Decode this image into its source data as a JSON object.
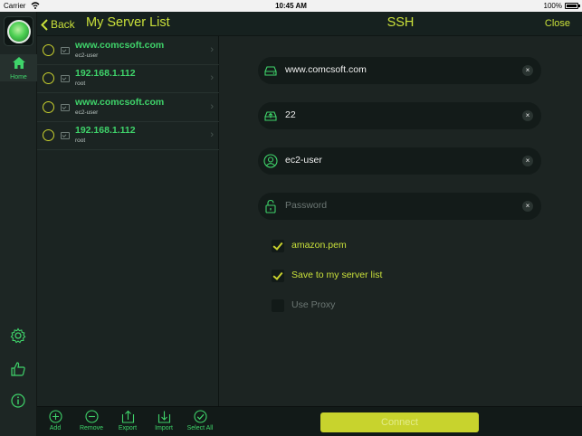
{
  "status_bar": {
    "carrier": "Carrier",
    "time": "10:45 AM",
    "battery": "100%"
  },
  "rail": {
    "home_label": "Home"
  },
  "server_list": {
    "back_label": "Back",
    "title": "My Server List",
    "servers": [
      {
        "host": "www.comcsoft.com",
        "user": "ec2-user"
      },
      {
        "host": "192.168.1.112",
        "user": "root"
      },
      {
        "host": "www.comcsoft.com",
        "user": "ec2-user"
      },
      {
        "host": "192.168.1.112",
        "user": "root"
      }
    ],
    "toolbar": {
      "add": "Add",
      "remove": "Remove",
      "export": "Export",
      "import": "Import",
      "select_all": "Select All"
    }
  },
  "ssh_form": {
    "title": "SSH",
    "close_label": "Close",
    "host_value": "www.comcsoft.com",
    "port_value": "22",
    "username_value": "ec2-user",
    "password_placeholder": "Password",
    "clear_glyph": "×",
    "options": [
      {
        "label": "amazon.pem",
        "checked": true
      },
      {
        "label": "Save to my server list",
        "checked": true
      },
      {
        "label": "Use Proxy",
        "checked": false
      }
    ],
    "connect_label": "Connect"
  },
  "colors": {
    "accent": "#c9e03a",
    "host_green": "#3fd36a",
    "background": "#1c2422"
  }
}
